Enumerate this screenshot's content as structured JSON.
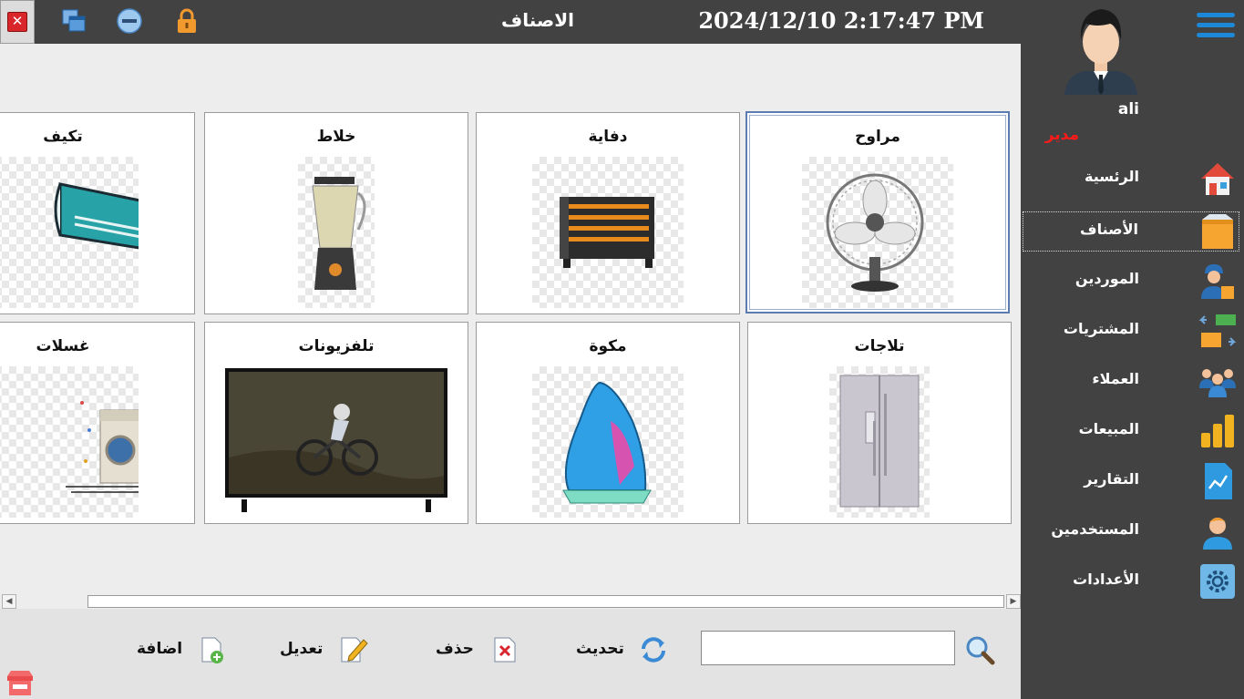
{
  "window": {
    "title": "الاصناف",
    "datetime": "2024/12/10 2:17:47 PM",
    "close_icon": "close-icon",
    "restore_icon": "restore-windows-icon",
    "minimize_icon": "minimize-icon",
    "lock_icon": "lock-icon"
  },
  "sidebar": {
    "user_name": "ali",
    "user_role": "مدير",
    "items": [
      {
        "label": "الرئسية",
        "icon": "home-icon"
      },
      {
        "label": "الأصناف",
        "icon": "box-icon",
        "active": true
      },
      {
        "label": "الموردين",
        "icon": "supplier-icon"
      },
      {
        "label": "المشتريات",
        "icon": "purchases-icon"
      },
      {
        "label": "العملاء",
        "icon": "customers-icon"
      },
      {
        "label": "المبيعات",
        "icon": "sales-coins-icon"
      },
      {
        "label": "التقارير",
        "icon": "report-chart-icon"
      },
      {
        "label": "المستخدمين",
        "icon": "user-icon"
      },
      {
        "label": "الأعدادات",
        "icon": "settings-gear-icon"
      }
    ]
  },
  "categories": [
    {
      "name": "مراوح",
      "image": "fan",
      "selected": true
    },
    {
      "name": "دفاية",
      "image": "heater"
    },
    {
      "name": "خلاط",
      "image": "blender"
    },
    {
      "name": "تكيف",
      "image": "air-conditioner"
    },
    {
      "name": "تلاجات",
      "image": "refrigerator"
    },
    {
      "name": "مكوة",
      "image": "iron"
    },
    {
      "name": "تلفزيونات",
      "image": "television"
    },
    {
      "name": "غسلات",
      "image": "washing-machine"
    }
  ],
  "toolbar": {
    "search_placeholder": "",
    "search_value": "",
    "refresh_label": "تحديث",
    "delete_label": "حذف",
    "edit_label": "تعديل",
    "add_label": "اضافة"
  },
  "colors": {
    "dark_panel": "#424242",
    "accent_blue": "#1e88d8",
    "role_red": "#ff1a1a",
    "close_red": "#d9262b"
  }
}
